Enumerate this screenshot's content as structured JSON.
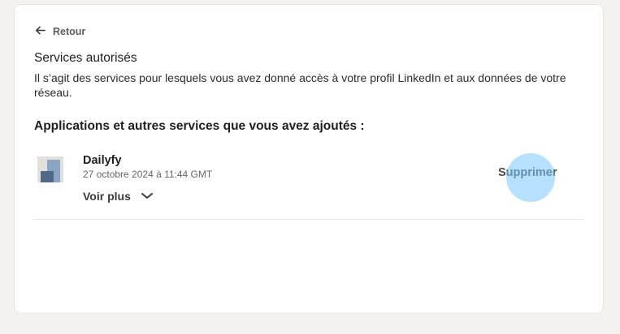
{
  "back": {
    "label": "Retour",
    "icon": "arrow-left-icon"
  },
  "page": {
    "title": "Services autorisés",
    "description": "Il s’agit des services pour lesquels vous avez donné accès à votre profil LinkedIn et aux données de votre réseau.",
    "section_title": "Applications et autres services que vous avez ajoutés :"
  },
  "apps": [
    {
      "name": "Dailyfy",
      "date": "27 octobre 2024 à 11:44 GMT",
      "more_label": "Voir plus",
      "remove_label": "Supprimer"
    }
  ],
  "colors": {
    "background": "#f4f2ee",
    "card": "#ffffff",
    "click_indicator": "#78c8ff"
  }
}
